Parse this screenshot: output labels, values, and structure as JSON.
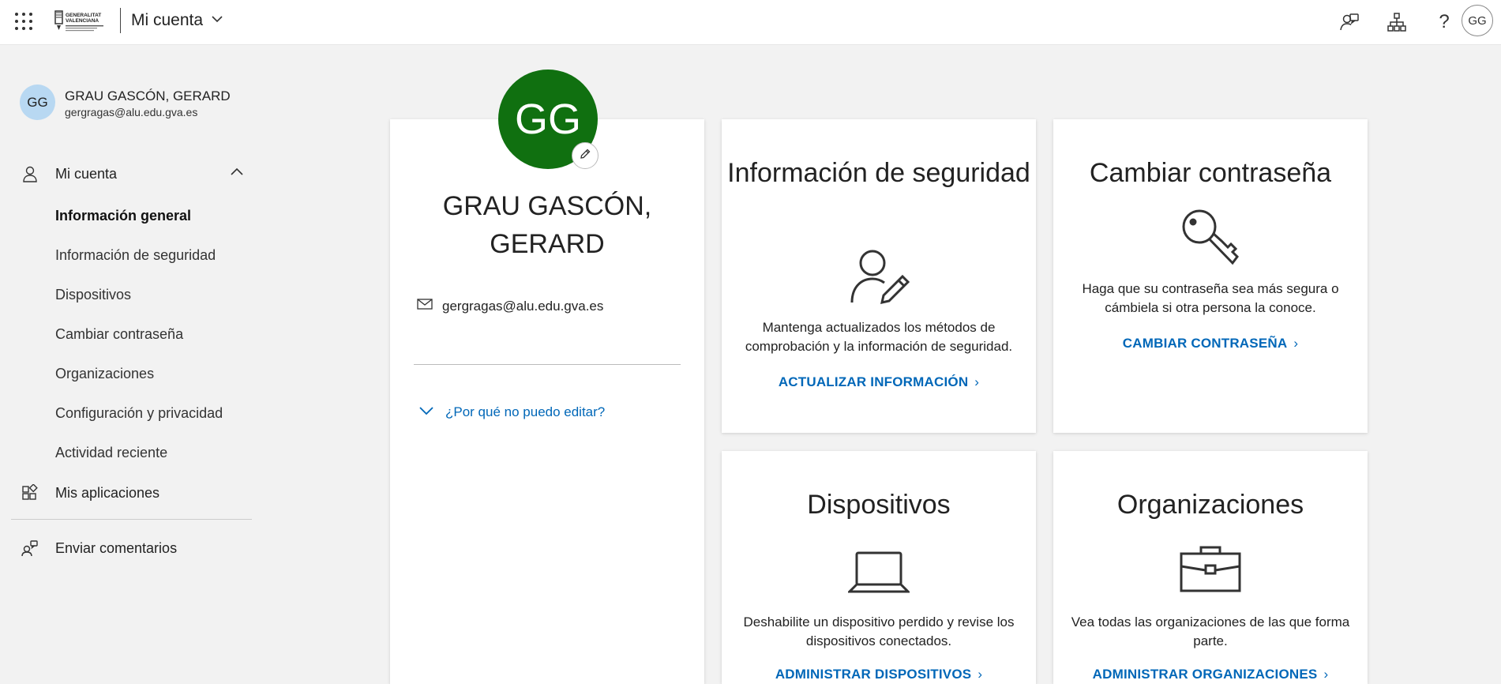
{
  "header": {
    "logo_text": [
      "GENERALITAT",
      "VALENCIANA"
    ],
    "app_title": "Mi cuenta",
    "avatar_initials": "GG",
    "icons": [
      "waffle-icon",
      "feedback-person-icon",
      "org-chart-icon",
      "help-icon"
    ]
  },
  "sidebar": {
    "user_initials": "GG",
    "user_name": "GRAU GASCÓN, GERARD",
    "user_email": "gergragas@alu.edu.gva.es",
    "sections": [
      {
        "label": "Mi cuenta",
        "icon": "person-icon",
        "expanded": true
      },
      {
        "label": "Mis aplicaciones",
        "icon": "apps-icon"
      },
      {
        "label": "Enviar comentarios",
        "icon": "feedback-icon"
      }
    ],
    "items": [
      {
        "label": "Información general",
        "active": true
      },
      {
        "label": "Información de seguridad"
      },
      {
        "label": "Dispositivos"
      },
      {
        "label": "Cambiar contraseña"
      },
      {
        "label": "Organizaciones"
      },
      {
        "label": "Configuración y privacidad"
      },
      {
        "label": "Actividad reciente"
      }
    ]
  },
  "profile": {
    "initials": "GG",
    "avatar_color": "#107010",
    "name": "GRAU GASCÓN, GERARD",
    "email": "gergragas@alu.edu.gva.es",
    "why_link": "¿Por qué no puedo editar?"
  },
  "tiles": {
    "security": {
      "title": "Información de seguridad",
      "description": "Mantenga actualizados los métodos de comprobación y la información de seguridad.",
      "link": "ACTUALIZAR INFORMACIÓN",
      "icon": "person-edit-icon"
    },
    "password": {
      "title": "Cambiar contraseña",
      "description": "Haga que su contraseña sea más segura o cámbiela si otra persona la conoce.",
      "link": "CAMBIAR CONTRASEÑA",
      "icon": "key-icon"
    },
    "devices": {
      "title": "Dispositivos",
      "description": "Deshabilite un dispositivo perdido y revise los dispositivos conectados.",
      "link": "ADMINISTRAR DISPOSITIVOS",
      "icon": "laptop-icon"
    },
    "organizations": {
      "title": "Organizaciones",
      "description": "Vea todas las organizaciones de las que forma parte.",
      "link": "ADMINISTRAR ORGANIZACIONES",
      "icon": "briefcase-icon"
    }
  },
  "colors": {
    "link": "#0067b8",
    "background": "#f2f2f2"
  }
}
